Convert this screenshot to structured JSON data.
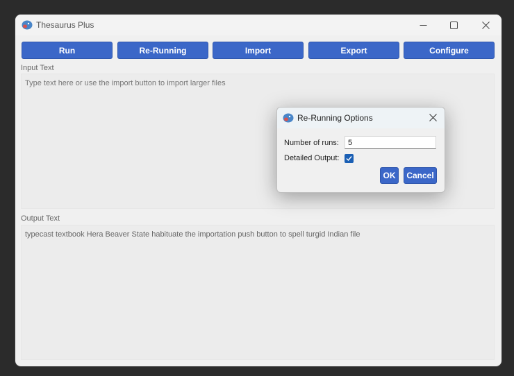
{
  "window": {
    "title": "Thesaurus Plus",
    "controls": {
      "minimize_icon": "minimize-icon",
      "maximize_icon": "maximize-icon",
      "close_icon": "close-icon"
    }
  },
  "toolbar": {
    "buttons": [
      "Run",
      "Re-Running",
      "Import",
      "Export",
      "Configure"
    ],
    "accent_color": "#3b67c8"
  },
  "input": {
    "label": "Input Text",
    "placeholder": "Type text here or use the import button to import larger files"
  },
  "output": {
    "label": "Output Text",
    "value": "typecast textbook Hera Beaver State habituate the importation push button to spell turgid Indian file"
  },
  "dialog": {
    "title": "Re-Running Options",
    "runs_label": "Number of runs:",
    "runs_value": "5",
    "detailed_label": "Detailed Output:",
    "detailed_checked": true,
    "ok_label": "OK",
    "cancel_label": "Cancel"
  }
}
